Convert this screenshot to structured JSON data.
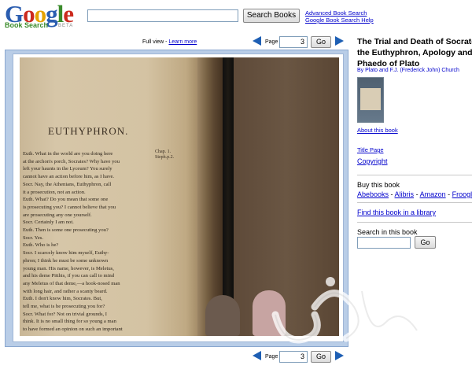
{
  "header": {
    "logo_letters": [
      "G",
      "o",
      "o",
      "g",
      "l",
      "e"
    ],
    "logo_colors": [
      "#2a5db0",
      "#cc2a1e",
      "#e5a200",
      "#2a5db0",
      "#3b8b2b",
      "#cc2a1e"
    ],
    "product": "Book Search",
    "beta": "BETA",
    "search_value": "",
    "search_button": "Search Books",
    "advanced_link": "Advanced Book Search",
    "help_link": "Google Book Search Help"
  },
  "viewer": {
    "view_label": "Full view - ",
    "learn_more": "Learn more",
    "page_label": "Page",
    "page_value": "3",
    "go_label": "Go",
    "prev_icon": "previous-page-icon",
    "next_icon": "next-page-icon",
    "bottom_page_label": "Page",
    "bottom_page_value": "3",
    "bottom_go_label": "Go"
  },
  "page_text": {
    "heading": "EUTHYPHRON.",
    "margin_note": [
      "Chap. 1.",
      "Steph.p.2."
    ],
    "lines": [
      "Euth. What in the world are you doing here",
      "at the archon's porch, Socrates? Why have you",
      "left your haunts in the Lyceum? You surely",
      "cannot have an action before him, as I have.",
      "Socr. Nay, the Athenians, Euthyphron, call",
      "it a prosecution, not an action.",
      "Euth. What? Do you mean that some one",
      "is prosecuting you? I cannot believe that you",
      "are prosecuting any one yourself.",
      "Socr. Certainly I am not.",
      "Euth. Then is some one prosecuting you?",
      "Socr. Yes.",
      "Euth. Who is he?",
      "Socr. I scarcely know him myself, Euthy-",
      "phron; I think he must be some unknown",
      "young man. His name, however, is Meletus,",
      "and his deme Pitthis, if you can call to mind",
      "any Meletus of that deme,—a hook-nosed man",
      "with long hair, and rather a scanty beard.",
      "Euth. I don't know him, Socrates. But,",
      "tell me, what is he prosecuting you for?",
      "Socr. What for? Not on trivial grounds, I",
      "think. It is no small thing for so young a man",
      "to have formed an opinion on such an important"
    ]
  },
  "book": {
    "title_lines": [
      "The Trial and Death of Socrates:",
      "the Euthyphron, Apology and",
      "Phaedo of Plato"
    ],
    "authors": "By Plato and F.J. (Frederick John) Church",
    "about_link": "About this book",
    "title_page_link": "Title Page",
    "copyright_link": "Copyright",
    "buy_heading": "Buy this book",
    "buy_links": [
      "Abebooks",
      "Alibris",
      "Amazon",
      "Froogle"
    ],
    "buy_separator": " - ",
    "library_link": "Find this book in a library",
    "search_heading": "Search in this book",
    "search_value": "",
    "search_go": "Go"
  },
  "colors": {
    "link": "#0000cc",
    "nav_arrow": "#1e5fb4",
    "viewer_border": "#b9cde7"
  }
}
